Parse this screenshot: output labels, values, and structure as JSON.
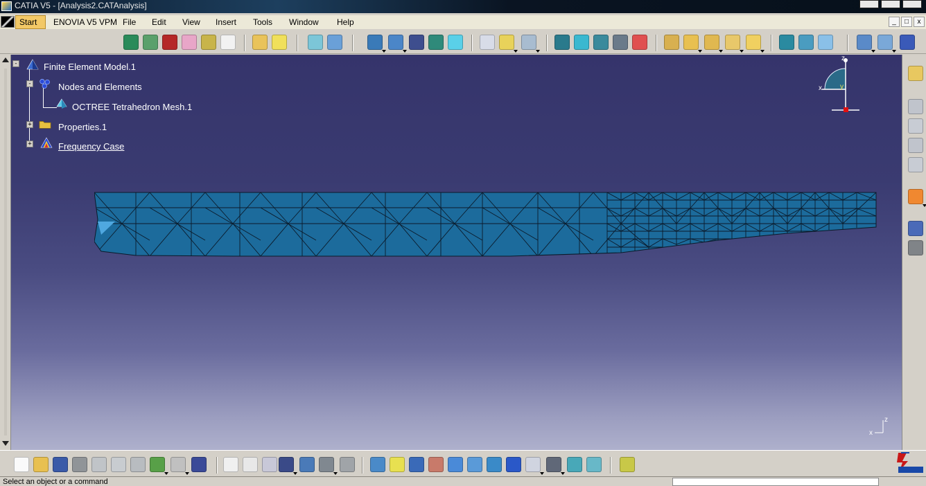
{
  "window": {
    "title": "CATIA V5 - [Analysis2.CATAnalysis]"
  },
  "menu": {
    "items": [
      "Start",
      "ENOVIA V5 VPM",
      "File",
      "Edit",
      "View",
      "Insert",
      "Tools",
      "Window",
      "Help"
    ],
    "mdi_controls": [
      "_",
      "□",
      "x"
    ]
  },
  "tree": {
    "root": "Finite Element Model.1",
    "nodes_and_elements": "Nodes and Elements",
    "mesh": "OCTREE Tetrahedron Mesh.1",
    "properties": "Properties.1",
    "frequency_case": "Frequency Case"
  },
  "compass": {
    "x": "x",
    "y": "y",
    "z": "z"
  },
  "axis_small": {
    "x": "x",
    "z": "z"
  },
  "status": {
    "message": "Select an object or a command"
  },
  "colors": {
    "mesh": "#1c6b9c",
    "mesh_edge": "#0b1a2a",
    "viewport_top": "#35346b",
    "viewport_bottom": "#aeb0cc",
    "start_highlight": "#f2c866"
  },
  "icons_top": [
    "drawing-icon",
    "image-icon",
    "book-icon",
    "paint-icon",
    "material-icon",
    "settings-icon",
    "open-icon",
    "save-icon",
    "mesh-icon",
    "mesh2-icon",
    "cube1-icon",
    "cube2-icon",
    "cube3-icon",
    "cube4-icon",
    "cube5-icon",
    "line-icon",
    "hand-icon",
    "arrows-icon",
    "restraint1-icon",
    "restraint2-icon",
    "restraint3-icon",
    "restraint4-icon",
    "graph-icon",
    "load1-icon",
    "load2-icon",
    "load3-icon",
    "load4-icon",
    "load5-icon",
    "compute1-icon",
    "compute2-icon",
    "compute3-icon",
    "image1-icon",
    "image2-icon",
    "image3-icon"
  ],
  "icons_bottom": [
    "new-icon",
    "open-icon",
    "save-icon",
    "print-icon",
    "cut-icon",
    "copy-icon",
    "paste-icon",
    "undo-icon",
    "redo-icon",
    "whats-this-icon",
    "formula-icon",
    "comment-icon",
    "knowledge-icon",
    "table-icon",
    "tree-icon",
    "lock-icon",
    "analysis-icon",
    "fly-icon",
    "fit-icon",
    "pan-icon",
    "rotate-icon",
    "zoom-in-icon",
    "zoom-out-icon",
    "normal-view-icon",
    "iso-view-icon",
    "view-cube-icon",
    "hide-show-icon",
    "swap-icon",
    "render-icon",
    "network-icon"
  ]
}
